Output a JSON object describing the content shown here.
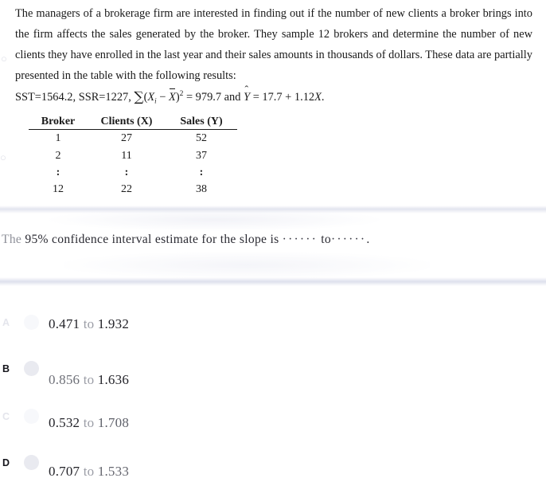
{
  "problem": {
    "statement": "The managers of a brokerage firm are interested in finding out if the number of new clients a broker brings into the firm affects the sales generated by the broker. They sample 12 brokers and determine the number of new clients they have enrolled in the last year and their sales amounts in thousands of dollars. These data are partially presented in the table with the following results:",
    "formula": {
      "sst_label": "SST=1564.2,",
      "ssr_label": "SSR=1227,",
      "sum_symbol": "∑",
      "sum_open": "(",
      "sum_var": "X",
      "sum_index": "i",
      "sum_minus": "−",
      "sum_mean_var": "X",
      "sum_close": ")",
      "sum_exponent": "2",
      "sum_equals": "= 979.7",
      "and_word": "and",
      "yhat_var": "Y",
      "yhat_hat": "ˆ",
      "regression": "= 17.7 + 1.12",
      "regression_var": "X",
      "period": "."
    }
  },
  "table": {
    "headers": [
      "Broker",
      "Clients (X)",
      "Sales (Y)"
    ],
    "rows": [
      [
        "1",
        "27",
        "52"
      ],
      [
        "2",
        "11",
        "37"
      ],
      [
        ":",
        ":",
        ":"
      ],
      [
        "12",
        "22",
        "38"
      ]
    ]
  },
  "question": {
    "prefix_first_word": "The",
    "text": "95% confidence interval estimate for the slope is",
    "blank_left": "······",
    "to_word": "to",
    "blank_right": "······",
    "period": "."
  },
  "options": [
    {
      "letter": "A",
      "lower": "0.471",
      "connector": "to",
      "upper": "1.932",
      "selected": false,
      "letter_faded": true,
      "radio_faded": true
    },
    {
      "letter": "B",
      "lower": "0.856",
      "connector": "to",
      "upper": "1.636",
      "selected": false,
      "letter_faded": false,
      "radio_faded": false
    },
    {
      "letter": "C",
      "lower": "0.532",
      "connector": "to",
      "upper": "1.708",
      "selected": false,
      "letter_faded": true,
      "radio_faded": true
    },
    {
      "letter": "D",
      "lower": "0.707",
      "connector": "to",
      "upper": "1.533",
      "selected": false,
      "letter_faded": false,
      "radio_faded": false
    }
  ],
  "artifacts": {
    "edge_mark_1": "○",
    "edge_mark_2": "○"
  }
}
